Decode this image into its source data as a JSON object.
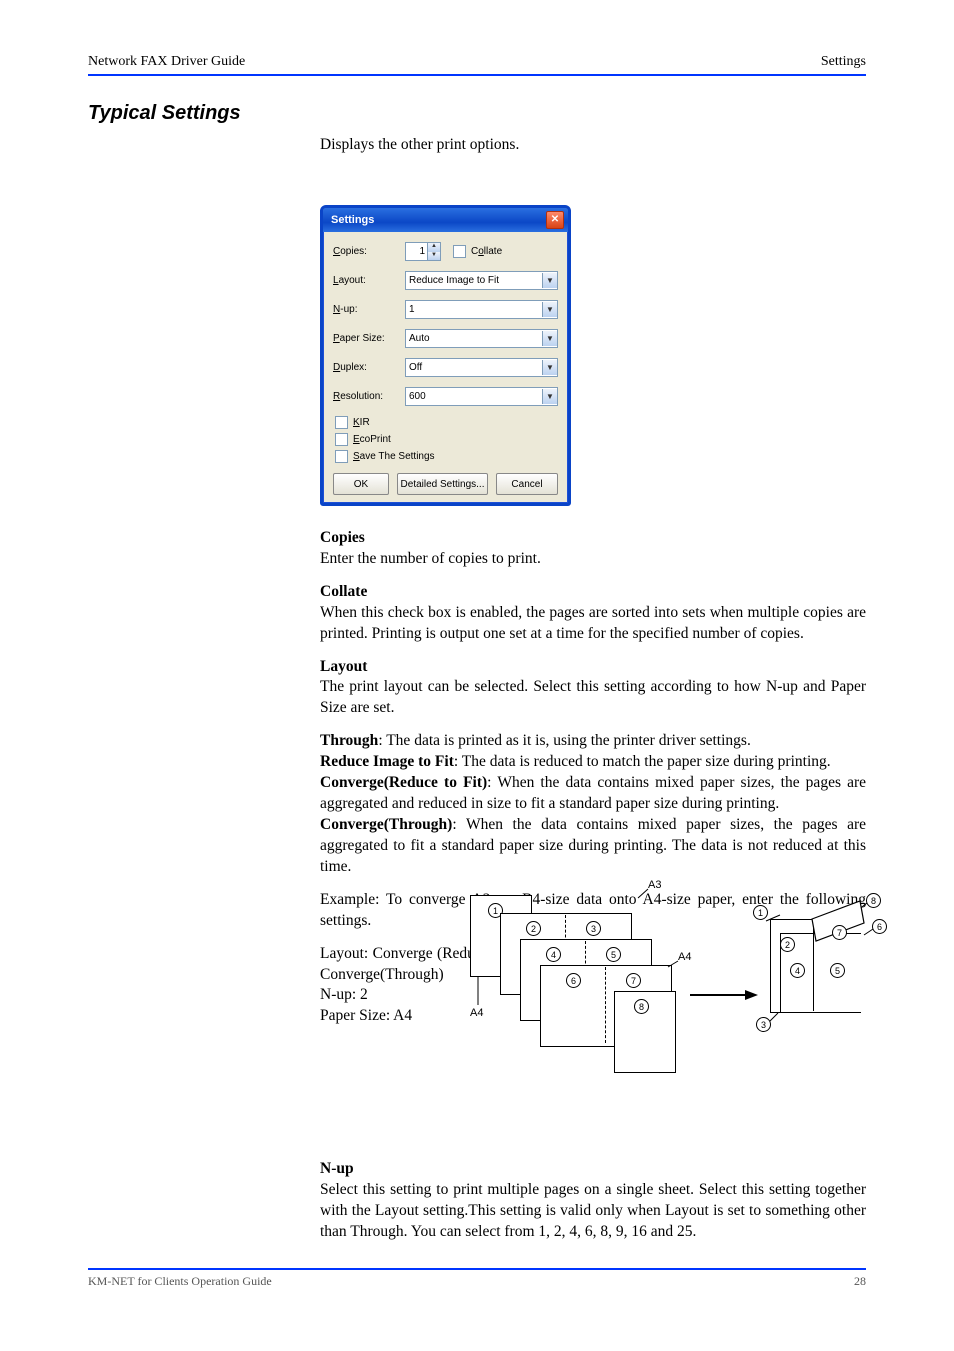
{
  "header": {
    "left": "Network FAX Driver Guide",
    "right": "Settings "
  },
  "heading": "Typical Settings",
  "intro": "Displays the other print options.",
  "dialog": {
    "title": "Settings",
    "copies_label": "Copies:",
    "copies_value": "1",
    "collate_label": "Collate",
    "layout_label": "Layout:",
    "layout_value": "Reduce Image to Fit",
    "nup_label": "N-up:",
    "nup_value": "1",
    "paper_label": "Paper Size:",
    "paper_value": "Auto",
    "duplex_label": "Duplex:",
    "duplex_value": "Off",
    "resolution_label": "Resolution:",
    "resolution_value": "600",
    "kir_label": "KIR",
    "ecoprint_label": "EcoPrint",
    "save_label": "Save The Settings",
    "btn_ok": "OK",
    "btn_detailed": "Detailed Settings...",
    "btn_cancel": "Cancel"
  },
  "fields": {
    "copies": {
      "title": "Copies",
      "text": "Enter the number of copies to print."
    },
    "collate": {
      "title": "Collate",
      "text": "When this check box is enabled, the pages are sorted into sets when multiple copies are printed. Printing is output one set at a time for the specified number of copies."
    },
    "layout": {
      "title": "Layout",
      "text": "The print layout can be selected. Select this setting according to how N-up and Paper Size are set.",
      "items": [
        {
          "name": "Through",
          "desc": "The data is printed as it is, using the printer driver settings."
        },
        {
          "name": "Reduce Image to Fit",
          "desc": "The data is reduced to match the paper size during printing."
        },
        {
          "name": "Converge(Reduce to Fit)",
          "desc": "When the data contains mixed paper sizes, the pages are aggregated and reduced in size to fit a standard paper size during printing."
        },
        {
          "name": "Converge(Through)",
          "desc": "When the data contains mixed paper sizes, the pages are aggregated to fit a standard paper size during printing. The data is not reduced at this time."
        }
      ],
      "example_lead": "Example: To converge A3- or B4-size data onto A4-size paper, enter the following settings.",
      "example_lines": [
        "Layout: Converge (Reduce to Fit) or Converge(Through)",
        "N-up: 2",
        "Paper Size: A4"
      ]
    },
    "nup": {
      "title": "N-up",
      "text": "Select this setting to print multiple pages on a single sheet. Select this setting together with the Layout setting.This setting is valid only when Layout is set to something other than Through. You can select from 1, 2, 4, 6, 8, 9, 16 and 25."
    }
  },
  "diagram_labels": {
    "A3": "A3",
    "A4": "A4"
  },
  "footer": {
    "left": "KM-NET for Clients Operation Guide",
    "right": "28"
  }
}
